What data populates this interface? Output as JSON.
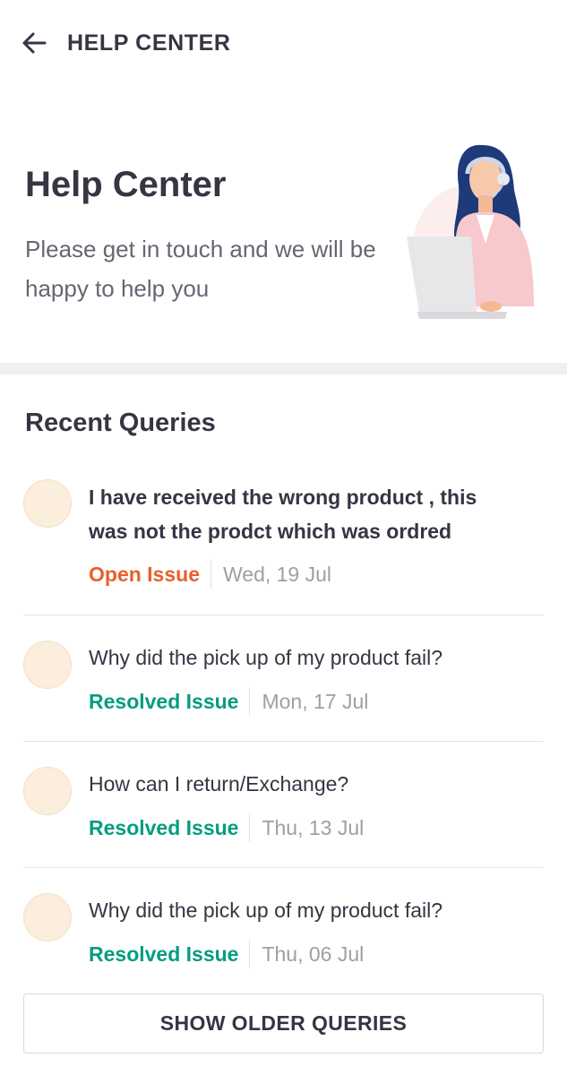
{
  "header": {
    "title": "HELP CENTER",
    "back_icon": "arrow-left-icon"
  },
  "hero": {
    "title": "Help Center",
    "subtitle": "Please get in touch and we will be happy to help you",
    "illustration": "support-agent-illustration"
  },
  "recent": {
    "title": "Recent Queries",
    "items": [
      {
        "text": "I have received the wrong product , this was not the prodct which was ordred",
        "status": "Open Issue",
        "date": "Wed, 19 Jul",
        "status_color": "#e8602c"
      },
      {
        "text": "Why did the pick up of my product fail?",
        "status": "Resolved Issue",
        "date": "Mon, 17 Jul",
        "status_color": "#039d7f"
      },
      {
        "text": "How can I return/Exchange?",
        "status": "Resolved Issue",
        "date": "Thu, 13 Jul",
        "status_color": "#039d7f"
      },
      {
        "text": "Why did the pick up of my product fail?",
        "status": "Resolved Issue",
        "date": "Thu, 06 Jul",
        "status_color": "#039d7f"
      }
    ]
  },
  "footer": {
    "older_button": "SHOW OLDER QUERIES"
  },
  "colors": {
    "open": "#e8602c",
    "resolved": "#039d7f",
    "text": "#353543",
    "avatar": "#fbeedc"
  }
}
